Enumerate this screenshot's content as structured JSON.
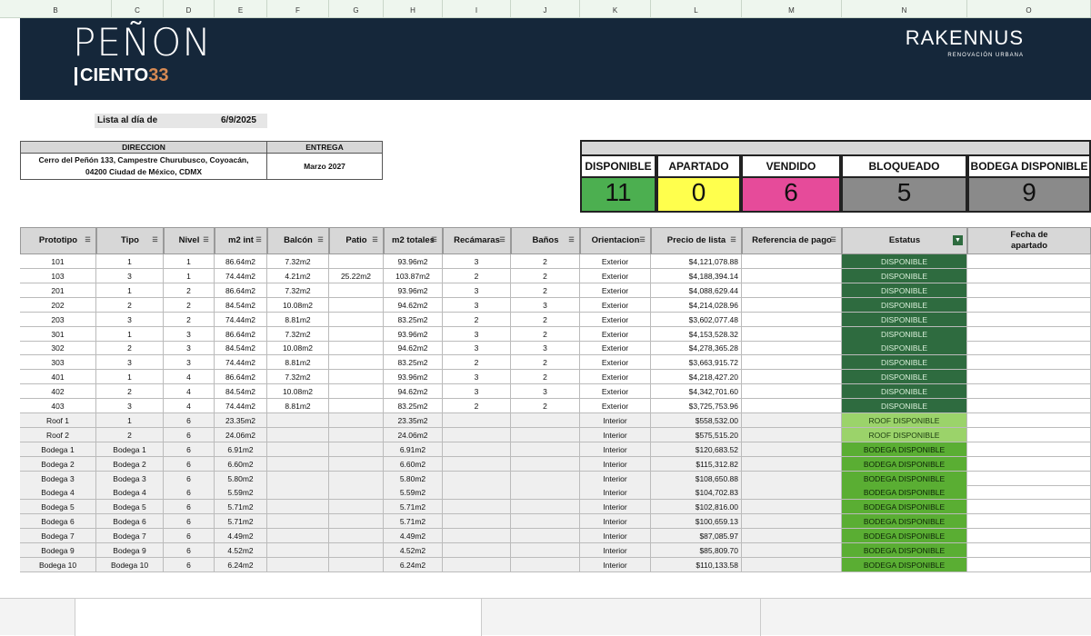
{
  "columns": [
    "B",
    "C",
    "D",
    "E",
    "F",
    "G",
    "H",
    "I",
    "J",
    "K",
    "L",
    "M",
    "N",
    "O"
  ],
  "banner": {
    "logo_line1": "PEÑON",
    "logo_word": "CIENTO",
    "logo_num": "33",
    "brand": "RAKENNUS",
    "brand_sub": "RENOVACIÓN URBANA",
    "bg_color": "#15273a"
  },
  "lista": {
    "label": "Lista al día de",
    "date": "6/9/2025"
  },
  "info": {
    "direccion_h": "DIRECCION",
    "direccion_line1": "Cerro del Peñón 133, Campestre Churubusco, Coyoacán,",
    "direccion_line2": "04200 Ciudad de México, CDMX",
    "entrega_h": "ENTREGA",
    "entrega_v": "Marzo  2027"
  },
  "summary": [
    {
      "label": "DISPONIBLE",
      "value": "11",
      "color": "#4caf50"
    },
    {
      "label": "APARTADO",
      "value": "0",
      "color": "#ffff4d"
    },
    {
      "label": "VENDIDO",
      "value": "6",
      "color": "#e64b9a"
    },
    {
      "label": "BLOQUEADO",
      "value": "5",
      "color": "#8a8a8a"
    },
    {
      "label": "BODEGA DISPONIBLE",
      "value": "9",
      "color": "#8a8a8a"
    }
  ],
  "table": {
    "headers": [
      "Prototipo",
      "Tipo",
      "Nivel",
      "m2 int",
      "Balcón",
      "Patio",
      "m2  totales",
      "Recámaras",
      "Baños",
      "Orientacion",
      "Precio de lista",
      "Referencia de pago",
      "Estatus",
      "Fecha de apartado"
    ],
    "rows": [
      [
        "101",
        "1",
        "1",
        "86.64m2",
        "7.32m2",
        "",
        "93.96m2",
        "3",
        "2",
        "Exterior",
        "$4,121,078.88",
        "",
        "DISPONIBLE",
        ""
      ],
      [
        "103",
        "3",
        "1",
        "74.44m2",
        "4.21m2",
        "25.22m2",
        "103.87m2",
        "2",
        "2",
        "Exterior",
        "$4,188,394.14",
        "",
        "DISPONIBLE",
        ""
      ],
      [
        "201",
        "1",
        "2",
        "86.64m2",
        "7.32m2",
        "",
        "93.96m2",
        "3",
        "2",
        "Exterior",
        "$4,088,629.44",
        "",
        "DISPONIBLE",
        ""
      ],
      [
        "202",
        "2",
        "2",
        "84.54m2",
        "10.08m2",
        "",
        "94.62m2",
        "3",
        "3",
        "Exterior",
        "$4,214,028.96",
        "",
        "DISPONIBLE",
        ""
      ],
      [
        "203",
        "3",
        "2",
        "74.44m2",
        "8.81m2",
        "",
        "83.25m2",
        "2",
        "2",
        "Exterior",
        "$3,602,077.48",
        "",
        "DISPONIBLE",
        ""
      ],
      [
        "301",
        "1",
        "3",
        "86.64m2",
        "7.32m2",
        "",
        "93.96m2",
        "3",
        "2",
        "Exterior",
        "$4,153,528.32",
        "",
        "DISPONIBLE",
        ""
      ],
      [
        "302",
        "2",
        "3",
        "84.54m2",
        "10.08m2",
        "",
        "94.62m2",
        "3",
        "3",
        "Exterior",
        "$4,278,365.28",
        "",
        "DISPONIBLE",
        ""
      ],
      [
        "303",
        "3",
        "3",
        "74.44m2",
        "8.81m2",
        "",
        "83.25m2",
        "2",
        "2",
        "Exterior",
        "$3,663,915.72",
        "",
        "DISPONIBLE",
        ""
      ],
      [
        "401",
        "1",
        "4",
        "86.64m2",
        "7.32m2",
        "",
        "93.96m2",
        "3",
        "2",
        "Exterior",
        "$4,218,427.20",
        "",
        "DISPONIBLE",
        ""
      ],
      [
        "402",
        "2",
        "4",
        "84.54m2",
        "10.08m2",
        "",
        "94.62m2",
        "3",
        "3",
        "Exterior",
        "$4,342,701.60",
        "",
        "DISPONIBLE",
        ""
      ],
      [
        "403",
        "3",
        "4",
        "74.44m2",
        "8.81m2",
        "",
        "83.25m2",
        "2",
        "2",
        "Exterior",
        "$3,725,753.96",
        "",
        "DISPONIBLE",
        ""
      ],
      [
        "Roof 1",
        "1",
        "6",
        "23.35m2",
        "",
        "",
        "23.35m2",
        "",
        "",
        "Interior",
        "$558,532.00",
        "",
        "ROOF DISPONIBLE",
        ""
      ],
      [
        "Roof 2",
        "2",
        "6",
        "24.06m2",
        "",
        "",
        "24.06m2",
        "",
        "",
        "Interior",
        "$575,515.20",
        "",
        "ROOF DISPONIBLE",
        ""
      ],
      [
        "Bodega 1",
        "Bodega 1",
        "6",
        "6.91m2",
        "",
        "",
        "6.91m2",
        "",
        "",
        "Interior",
        "$120,683.52",
        "",
        "BODEGA DISPONIBLE",
        ""
      ],
      [
        "Bodega 2",
        "Bodega 2",
        "6",
        "6.60m2",
        "",
        "",
        "6.60m2",
        "",
        "",
        "Interior",
        "$115,312.82",
        "",
        "BODEGA DISPONIBLE",
        ""
      ],
      [
        "Bodega 3",
        "Bodega 3",
        "6",
        "5.80m2",
        "",
        "",
        "5.80m2",
        "",
        "",
        "Interior",
        "$108,650.88",
        "",
        "BODEGA DISPONIBLE",
        ""
      ],
      [
        "Bodega 4",
        "Bodega 4",
        "6",
        "5.59m2",
        "",
        "",
        "5.59m2",
        "",
        "",
        "Interior",
        "$104,702.83",
        "",
        "BODEGA DISPONIBLE",
        ""
      ],
      [
        "Bodega 5",
        "Bodega 5",
        "6",
        "5.71m2",
        "",
        "",
        "5.71m2",
        "",
        "",
        "Interior",
        "$102,816.00",
        "",
        "BODEGA DISPONIBLE",
        ""
      ],
      [
        "Bodega 6",
        "Bodega 6",
        "6",
        "5.71m2",
        "",
        "",
        "5.71m2",
        "",
        "",
        "Interior",
        "$100,659.13",
        "",
        "BODEGA DISPONIBLE",
        ""
      ],
      [
        "Bodega 7",
        "Bodega 7",
        "6",
        "4.49m2",
        "",
        "",
        "4.49m2",
        "",
        "",
        "Interior",
        "$87,085.97",
        "",
        "BODEGA DISPONIBLE",
        ""
      ],
      [
        "Bodega 9",
        "Bodega 9",
        "6",
        "4.52m2",
        "",
        "",
        "4.52m2",
        "",
        "",
        "Interior",
        "$85,809.70",
        "",
        "BODEGA DISPONIBLE",
        ""
      ],
      [
        "Bodega 10",
        "Bodega 10",
        "6",
        "6.24m2",
        "",
        "",
        "6.24m2",
        "",
        "",
        "Interior",
        "$110,133.58",
        "",
        "BODEGA DISPONIBLE",
        ""
      ]
    ]
  }
}
